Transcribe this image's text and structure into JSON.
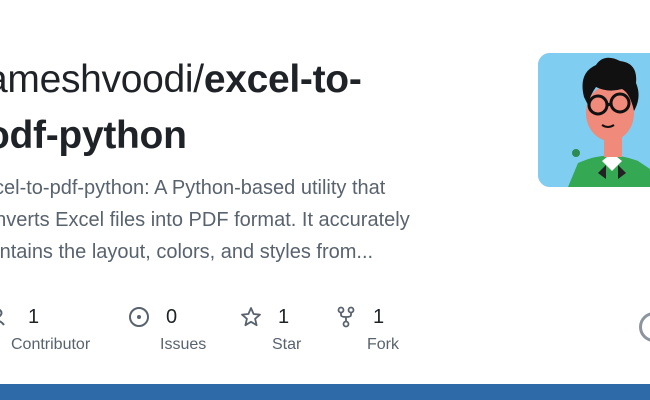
{
  "repo": {
    "owner_text": "ameshvoodi/",
    "name_line1": "excel-to-",
    "name_line2": "odf-python"
  },
  "description": {
    "line1": "xcel-to-pdf-python: A Python-based utility that",
    "line2": "onverts Excel files into PDF format. It accurately",
    "line3": "aintains the layout, colors, and styles from..."
  },
  "stats": [
    {
      "icon": "people-icon",
      "value": "1",
      "label": "Contributor"
    },
    {
      "icon": "issue-icon",
      "value": "0",
      "label": "Issues"
    },
    {
      "icon": "star-icon",
      "value": "1",
      "label": "Star"
    },
    {
      "icon": "fork-icon",
      "value": "1",
      "label": "Fork"
    }
  ],
  "colors": {
    "title": "#1f2328",
    "muted": "#59636e",
    "bottom_bar": "#2f6aa8",
    "avatar_bg": "#7fcdf0"
  }
}
